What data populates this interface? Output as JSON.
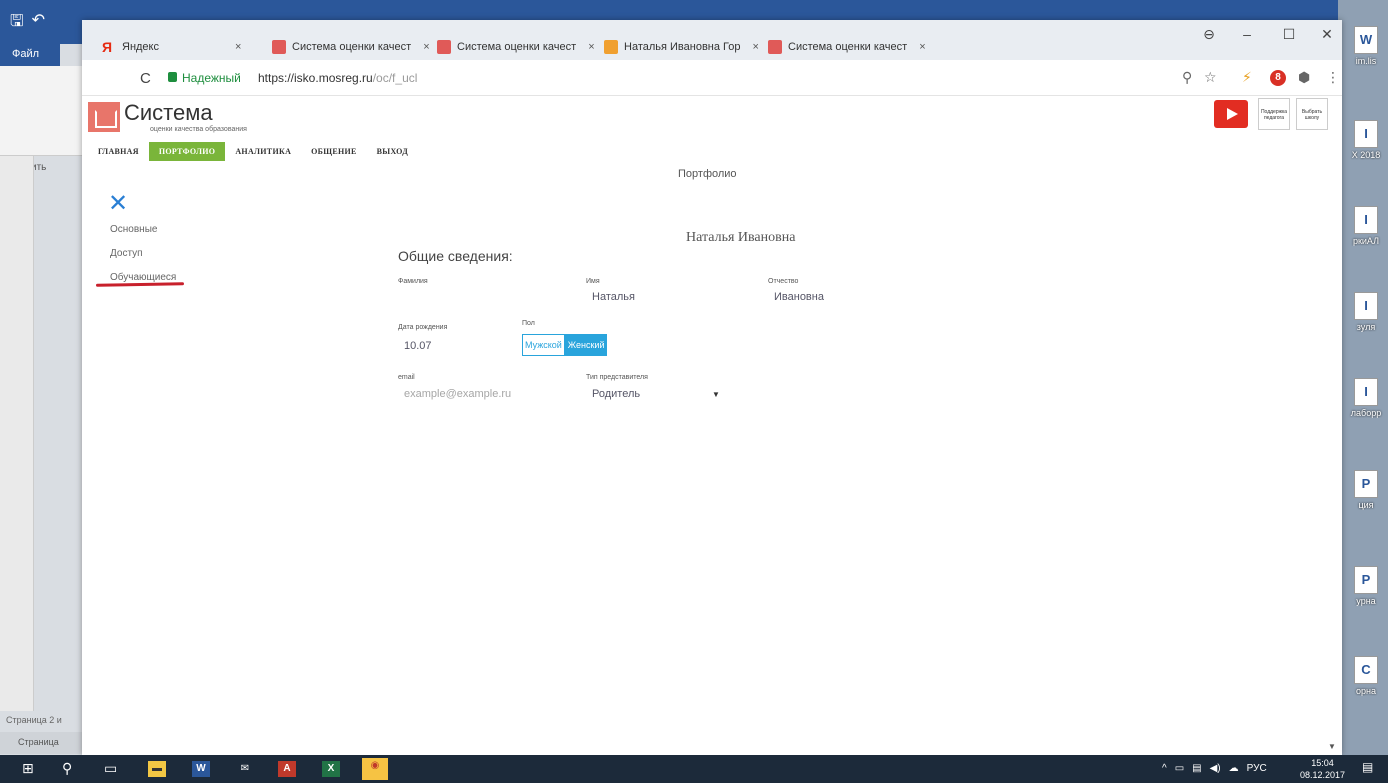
{
  "word": {
    "tab_file": "Файл",
    "paste": "Вставить",
    "status_1": "Страница 2 и",
    "status_2": "Страница"
  },
  "desktop_icons": [
    {
      "glyph": "W",
      "label": "im.lis"
    },
    {
      "glyph": "I",
      "label": "X 2018"
    },
    {
      "glyph": "I",
      "label": "ркиАЛ"
    },
    {
      "glyph": "I",
      "label": "зуля"
    },
    {
      "glyph": "I",
      "label": "лаборр"
    },
    {
      "glyph": "P",
      "label": "ция"
    },
    {
      "glyph": "P",
      "label": "урна"
    },
    {
      "glyph": "C",
      "label": "орна"
    }
  ],
  "browser": {
    "tabs": [
      {
        "label": "Яндекс",
        "favicon": "yandex-icon"
      },
      {
        "label": "Система оценки качест",
        "favicon": "site-icon"
      },
      {
        "label": "Система оценки качест",
        "favicon": "site-icon"
      },
      {
        "label": "Наталья Ивановна Гор",
        "favicon": "orange-icon"
      },
      {
        "label": "Система оценки качест",
        "favicon": "site-icon"
      }
    ],
    "tab_close": "×",
    "security_label": "Надежный",
    "url_host": "https://isko.mosreg.ru",
    "url_path": "/oc/f_ucl",
    "ext_badge": "8"
  },
  "site": {
    "logo_title": "Система",
    "logo_subtitle": "оценки качества образования",
    "promo_card_1": "Поддержка педагога",
    "promo_card_2": "Выбрать школу",
    "nav": [
      {
        "label": "ГЛАВНАЯ",
        "active": false
      },
      {
        "label": "ПОРТФОЛИО",
        "active": true
      },
      {
        "label": "АНАЛИТИКА",
        "active": false
      },
      {
        "label": "ОБЩЕНИЕ",
        "active": false
      },
      {
        "label": "ВЫХОД",
        "active": false
      }
    ],
    "page_heading": "Портфолио"
  },
  "sidebar": {
    "close": "✕",
    "items": [
      "Основные",
      "Доступ",
      "Обучающиеся"
    ],
    "active_index": 2
  },
  "profile": {
    "name": "Наталья Ивановна",
    "section_title": "Общие сведения:",
    "fields": {
      "surname_label": "Фамилия",
      "surname_value": "",
      "firstname_label": "Имя",
      "firstname_value": "Наталья",
      "patronymic_label": "Отчество",
      "patronymic_value": "Ивановна",
      "birthdate_label": "Дата рождения",
      "birthdate_value": "10.07",
      "gender_label": "Пол",
      "gender_options": [
        "Мужской",
        "Женский"
      ],
      "gender_selected": "Женский",
      "email_label": "email",
      "email_placeholder": "example@example.ru",
      "rep_type_label": "Тип представителя",
      "rep_type_value": "Родитель"
    }
  },
  "taskbar": {
    "tray_lang": "РУС",
    "time": "15:04",
    "date": "08.12.2017"
  },
  "colors": {
    "nav_active": "#7ab53a",
    "accent_blue": "#29a4dc",
    "logo_red": "#e8756a",
    "underline_red": "#c8202c"
  }
}
